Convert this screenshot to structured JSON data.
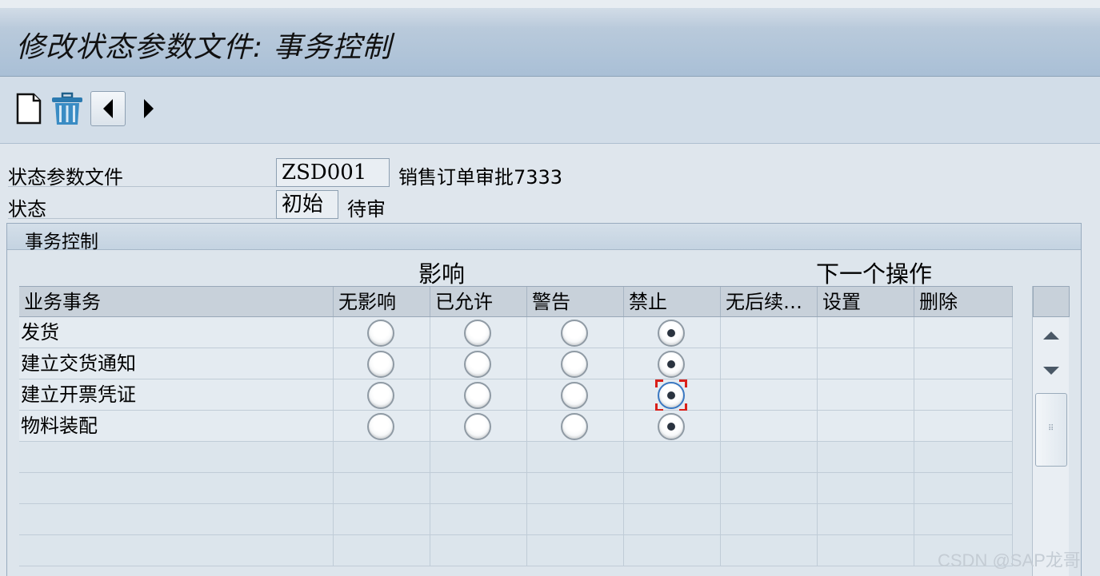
{
  "window": {
    "title": "修改状态参数文件: 事务控制"
  },
  "toolbar": {
    "icons": [
      "new-document-icon",
      "delete-trash-icon",
      "previous-icon",
      "next-icon"
    ]
  },
  "form": {
    "profile_label": "状态参数文件",
    "profile_value": "ZSD001",
    "profile_desc": "销售订单审批7333",
    "status_label": "状态",
    "status_value": "初始",
    "status_desc": "待审"
  },
  "group": {
    "title": "事务控制",
    "influence_label": "影响",
    "next_action_label": "下一个操作"
  },
  "table": {
    "headers": [
      "业务事务",
      "无影响",
      "已允许",
      "警告",
      "禁止",
      "无后续…",
      "设置",
      "删除"
    ],
    "rows": [
      {
        "name": "发货",
        "selected": 3
      },
      {
        "name": "建立交货通知",
        "selected": 3
      },
      {
        "name": "建立开票凭证",
        "selected": 3
      },
      {
        "name": "物料装配",
        "selected": 3
      }
    ],
    "focused_row": 2
  },
  "watermark": "CSDN @SAP龙哥",
  "colors": {
    "title_bg": "#a9bfd6",
    "focus": "#d9201a"
  }
}
